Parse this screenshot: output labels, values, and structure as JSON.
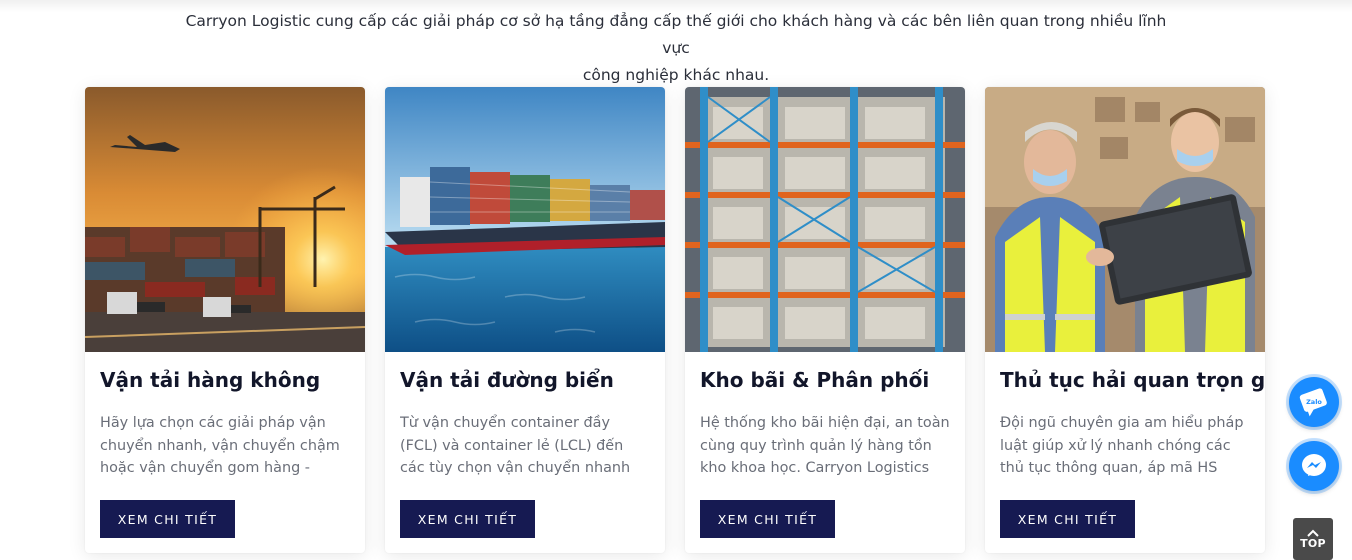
{
  "intro": {
    "line1": "Carryon Logistic cung cấp các giải pháp cơ sở hạ tầng đẳng cấp thế giới cho khách hàng và các bên liên quan trong nhiều lĩnh vực",
    "line2": "công nghiệp khác nhau."
  },
  "cards": [
    {
      "title": "Vận tải hàng không",
      "desc": "Hãy lựa chọn các giải pháp vận chuyển nhanh, vận chuyển chậm hoặc vận chuyển gom hàng - bao…",
      "button": "XEM CHI TIẾT",
      "image_icon": "air-freight-sunset-port-image"
    },
    {
      "title": "Vận tải đường biển",
      "desc": "Từ vận chuyển container đầy (FCL) và container lẻ (LCL) đến các tùy chọn vận chuyển nhanh và vận…",
      "button": "XEM CHI TIẾT",
      "image_icon": "container-ship-image"
    },
    {
      "title": "Kho bãi & Phân phối",
      "desc": "Hệ thống kho bãi hiện đại, an toàn cùng quy trình quản lý hàng tồn kho khoa học. Carryon Logistics không…",
      "button": "XEM CHI TIẾT",
      "image_icon": "warehouse-racks-image"
    },
    {
      "title": "Thủ tục hải quan trọn gói",
      "desc": "Đội ngũ chuyên gia am hiểu pháp luật giúp xử lý nhanh chóng các thủ tục thông quan, áp mã HS code…",
      "button": "XEM CHI TIẾT",
      "image_icon": "customs-workers-image"
    }
  ],
  "floating": {
    "zalo_label": "Zalo",
    "messenger_icon": "messenger-icon",
    "top_label": "TOP"
  },
  "colors": {
    "button_bg": "#161a52",
    "float_blue": "#1a8cff",
    "top_bg": "#4a4a4a"
  }
}
